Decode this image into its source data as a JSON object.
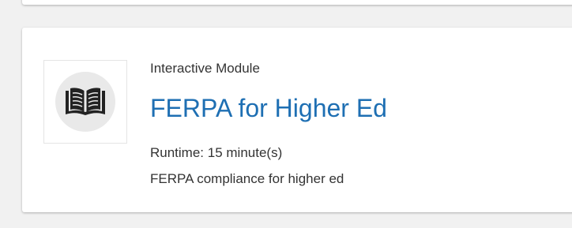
{
  "module": {
    "type_label": "Interactive Module",
    "title": "FERPA for Higher Ed",
    "runtime_label": "Runtime:",
    "runtime_value": "15 minute(s)",
    "description": "FERPA compliance for higher ed",
    "icon": "open-book-icon"
  },
  "colors": {
    "title": "#1e6fb3",
    "text": "#333333",
    "icon": "#222222",
    "icon_background": "#e9e9e9",
    "page_background": "#f1f1f1"
  }
}
